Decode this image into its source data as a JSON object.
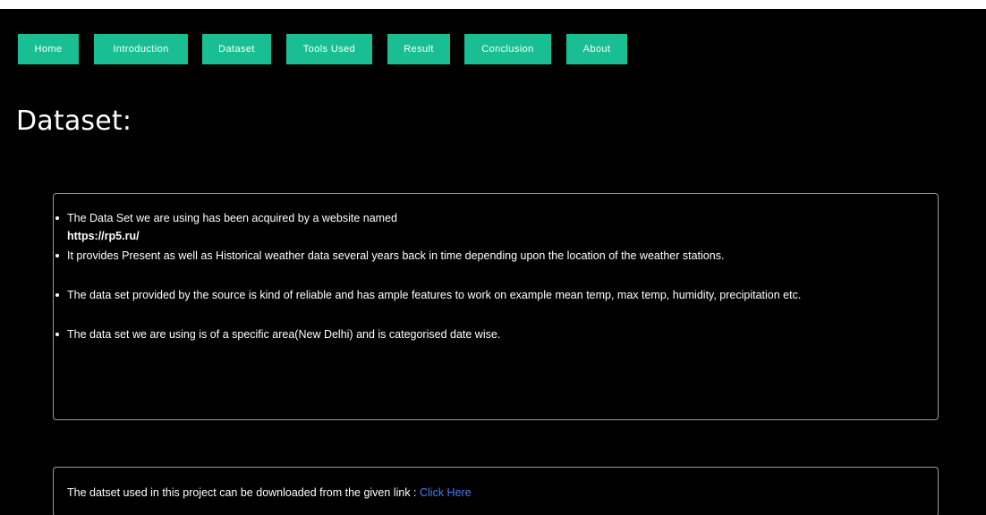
{
  "nav": {
    "items": [
      {
        "label": "Home"
      },
      {
        "label": "Introduction"
      },
      {
        "label": "Dataset"
      },
      {
        "label": "Tools Used"
      },
      {
        "label": "Result"
      },
      {
        "label": "Conclusion"
      },
      {
        "label": "About"
      }
    ]
  },
  "page_title": "Dataset:",
  "dataset_info": {
    "items": [
      "The Data Set we are using has been acquired by a website named",
      "It provides Present as well as Historical weather data several years back in time depending upon the location of the weather stations.",
      "The data set provided by the source is kind of reliable and has ample features to work on example mean temp, max temp, humidity, precipitation etc.",
      "The data set we are using is of a specific area(New Delhi) and is categorised date wise."
    ],
    "source_link": "https://rp5.ru/"
  },
  "download": {
    "text": "The datset used in this project can be downloaded from the given link :",
    "link_label": "Click Here"
  },
  "colors": {
    "background": "#000000",
    "nav_button": "#19bf92",
    "link": "#4a7cf0",
    "text": "#ffffff",
    "box_border": "#9a9a9a"
  }
}
